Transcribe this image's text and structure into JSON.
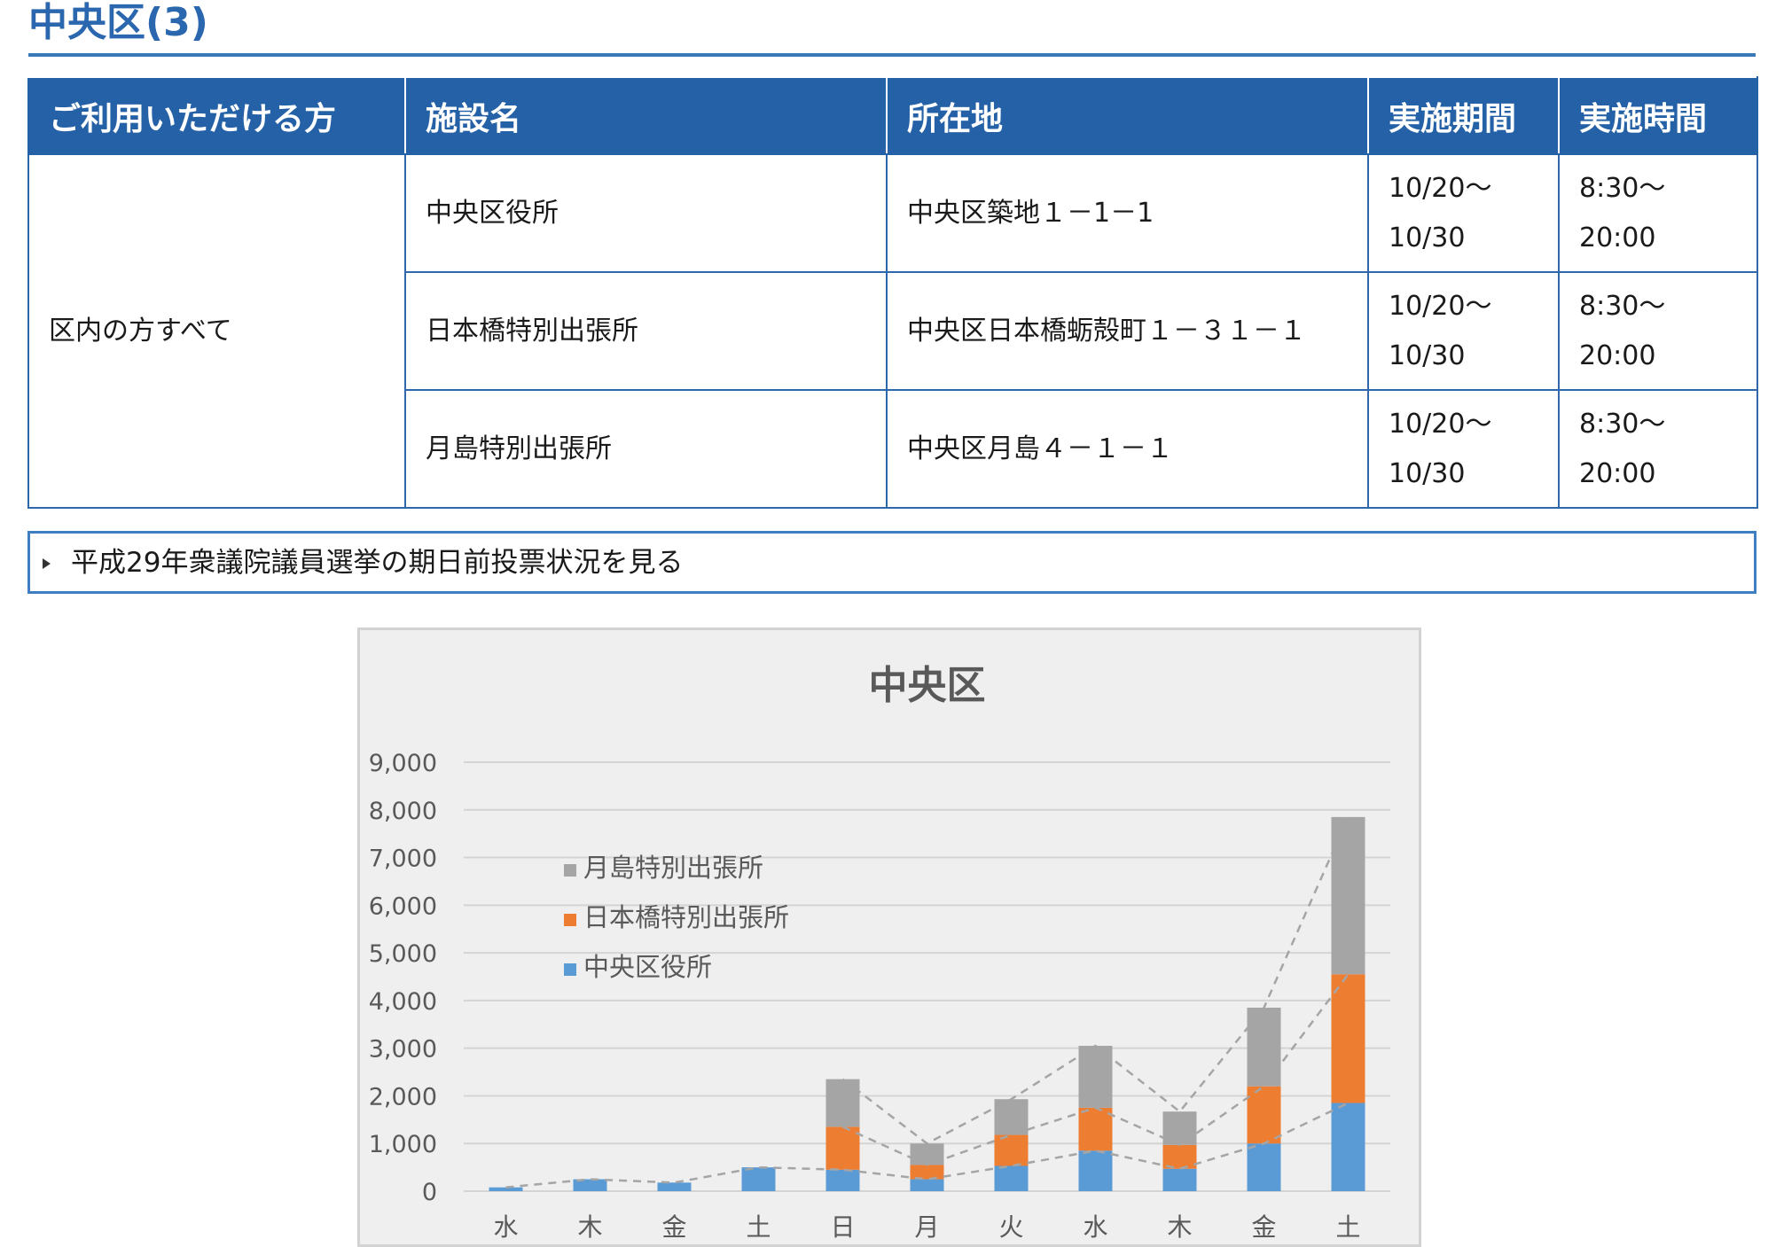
{
  "section_title": "中央区(3)",
  "table": {
    "headers": [
      "ご利用いただける方",
      "施設名",
      "所在地",
      "実施期間",
      "実施時間"
    ],
    "eligible": "区内の方すべて",
    "rows": [
      {
        "facility": "中央区役所",
        "address": "中央区築地１－1－1",
        "period_start": "10/20～",
        "period_end": "10/30",
        "time_start": "8:30～",
        "time_end": "20:00"
      },
      {
        "facility": "日本橋特別出張所",
        "address": "中央区日本橋蛎殻町１－３１－１",
        "period_start": "10/20～",
        "period_end": "10/30",
        "time_start": "8:30～",
        "time_end": "20:00"
      },
      {
        "facility": "月島特別出張所",
        "address": "中央区月島４－１－１",
        "period_start": "10/20～",
        "period_end": "10/30",
        "time_start": "8:30～",
        "time_end": "20:00"
      }
    ]
  },
  "expander": {
    "label": "平成29年衆議院議員選挙の期日前投票状況を見る"
  },
  "colors": {
    "header_bg": "#2561a6",
    "border": "#2f67ab",
    "title": "#2a67ae"
  },
  "chart_data": {
    "type": "bar",
    "stacked": true,
    "title": "中央区",
    "categories": [
      "水",
      "木",
      "金",
      "土",
      "日",
      "月",
      "火",
      "水",
      "木",
      "金",
      "土"
    ],
    "ylim": [
      0,
      9000
    ],
    "yticks": [
      "0",
      "1,000",
      "2,000",
      "3,000",
      "4,000",
      "5,000",
      "6,000",
      "7,000",
      "8,000",
      "9,000"
    ],
    "grid": true,
    "legend_position": "upper-left",
    "series_lines": "dashed cumulative lines connecting stack tops",
    "series": [
      {
        "name": "中央区役所",
        "color": "#5b9bd5",
        "values": [
          80,
          250,
          180,
          500,
          450,
          250,
          530,
          850,
          470,
          1000,
          1850
        ]
      },
      {
        "name": "日本橋特別出張所",
        "color": "#ed7d31",
        "values": [
          0,
          0,
          0,
          0,
          900,
          300,
          650,
          900,
          500,
          1200,
          2700
        ]
      },
      {
        "name": "月島特別出張所",
        "color": "#a5a5a5",
        "values": [
          0,
          0,
          0,
          0,
          1000,
          450,
          750,
          1300,
          700,
          1650,
          3300
        ]
      }
    ]
  }
}
